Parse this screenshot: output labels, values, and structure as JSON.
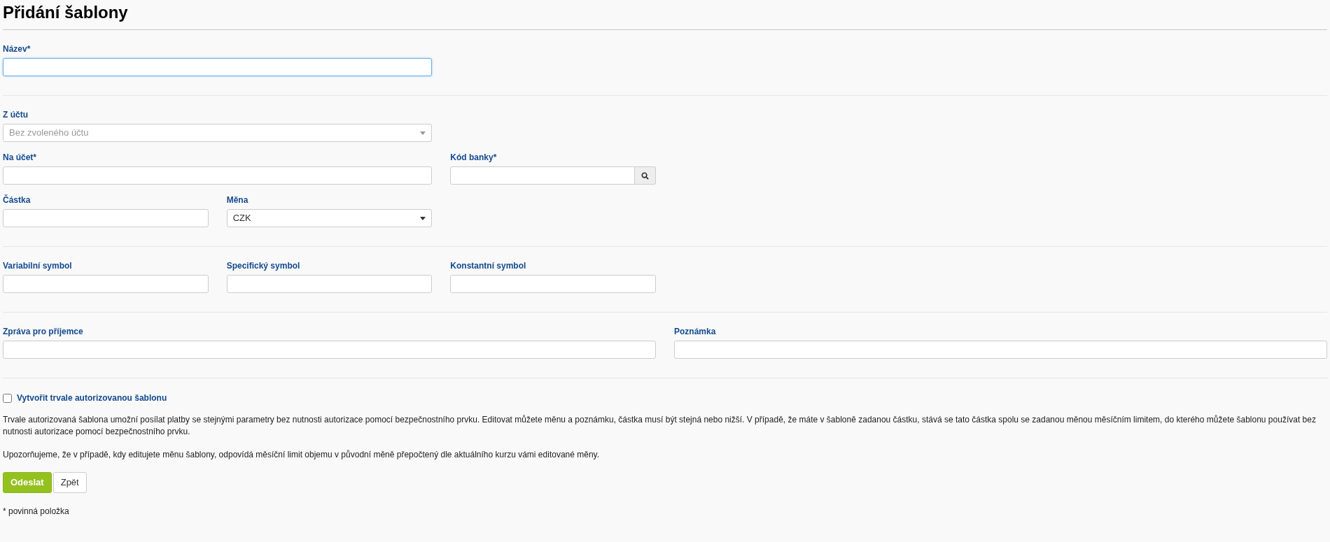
{
  "title": "Přidání šablony",
  "sections": [
    {
      "fields": [
        {
          "kind": "input",
          "label": "Název*",
          "focused": true
        }
      ]
    },
    {
      "fields": [
        {
          "kind": "select",
          "label": "Z účtu",
          "placeholder": "Bez zvoleného účtu"
        },
        {
          "kind": "input",
          "label": "Na účet*",
          "focused": false
        },
        {
          "kind": "search",
          "label": "Kód banky*"
        },
        {
          "kind": "input",
          "label": "Částka",
          "focused": false
        },
        {
          "kind": "select",
          "label": "Měna",
          "value": "CZK"
        }
      ]
    },
    {
      "fields": [
        {
          "kind": "input",
          "label": "Variabilní symbol",
          "focused": false
        },
        {
          "kind": "input",
          "label": "Specifický symbol",
          "focused": false
        },
        {
          "kind": "input",
          "label": "Konstantní symbol",
          "focused": false
        }
      ]
    },
    {
      "fields": [
        {
          "kind": "input",
          "label": "Zpráva pro příjemce",
          "focused": false
        },
        {
          "kind": "input",
          "label": "Poznámka",
          "focused": false
        }
      ]
    }
  ],
  "checkbox": {
    "label": "Vytvořit trvale autorizovanou šablonu",
    "checked": false
  },
  "paragraphs": [
    "Trvale autorizovaná šablona umožní posílat platby se stejnými parametry bez nutnosti autorizace pomocí bezpečnostního prvku. Editovat můžete měnu a poznámku, částka musí být stejná nebo nižší. V případě, že máte v šabloně zadanou částku, stává se tato částka spolu se zadanou měnou měsíčním limitem, do kterého můžete šablonu používat bez nutnosti autorizace pomocí bezpečnostního prvku.",
    "Upozorňujeme, že v případě, kdy editujete měnu šablony, odpovídá měsíční limit objemu v původní měně přepočtený dle aktuálního kurzu vámi editované měny."
  ],
  "buttons": [
    {
      "kind": "primary",
      "label": "Odeslat"
    },
    {
      "kind": "secondary",
      "label": "Zpět"
    }
  ],
  "footnote": "* povinná položka"
}
